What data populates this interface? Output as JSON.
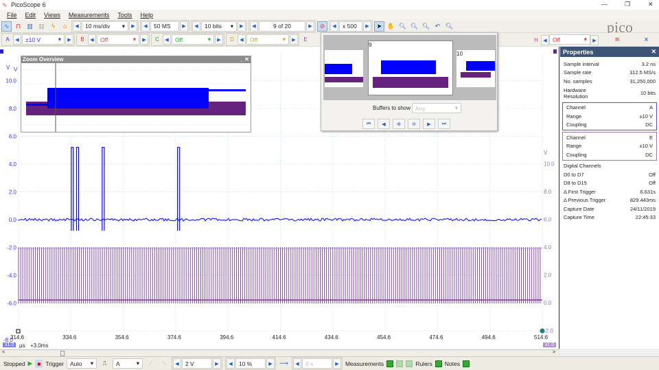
{
  "app": {
    "title": "PicoScope 6",
    "logo": "pico"
  },
  "menu": [
    "File",
    "Edit",
    "Views",
    "Measurements",
    "Tools",
    "Help"
  ],
  "toolbar1": {
    "timebase": "10 ms/div",
    "samples": "50 MS",
    "resolution": "10 bits",
    "buffer": "9 of 20",
    "zoom": "x 500"
  },
  "channels": [
    {
      "id": "A",
      "value": "±10 V",
      "color": "#3333ee"
    },
    {
      "id": "B",
      "value": "Off",
      "color": "#e03030"
    },
    {
      "id": "C",
      "value": "Off",
      "color": "#22aa22"
    },
    {
      "id": "D",
      "value": "Off",
      "color": "#c8a020"
    },
    {
      "id": "E",
      "value": "",
      "color": "#9a50b0"
    },
    {
      "id": "H",
      "value": "Off",
      "color": "#e0308a"
    }
  ],
  "overview": {
    "title": "Zoom Overview",
    "yunit": "V",
    "yticks": [
      "10.0",
      "8.0",
      "6.0"
    ]
  },
  "buffers": {
    "labels": [
      "9",
      "10"
    ],
    "buffers_to_show_label": "Buffers to show",
    "buffers_to_show_value": "Any"
  },
  "plot": {
    "left_axis": {
      "unit": "V",
      "ticks": [
        "10.0",
        "8.0",
        "6.0",
        "4.0",
        "2.0",
        "0.0",
        "-2.0",
        "-4.0",
        "-6.0",
        "-8.0"
      ],
      "color": "#3333ee"
    },
    "right_axis": {
      "unit": "V",
      "ticks": [
        "10.0",
        "8.0",
        "6.0",
        "4.0",
        "2.0",
        "0.0",
        "-2.0"
      ],
      "color": "#9a70b8"
    },
    "x_ticks": [
      "314.6",
      "334.6",
      "354.6",
      "374.6",
      "394.6",
      "414.6",
      "434.6",
      "454.6",
      "474.6",
      "494.6",
      "514.6"
    ],
    "x_unit": "µs",
    "x_offset": "+3.0ms",
    "left_scale_badge": "x1.0",
    "right_scale_badge": "x1.0",
    "pulse_times_us": [
      335.0,
      337.0,
      346.8,
      375.6
    ],
    "colors": {
      "channel_a": "#0000ff",
      "channel_e": "#7a3a9a"
    }
  },
  "properties": {
    "title": "Properties",
    "rows": [
      [
        "Sample interval",
        "3.2 ns"
      ],
      [
        "Sample rate",
        "312.5 MS/s"
      ],
      [
        "No. samples",
        "31,250,000"
      ],
      [
        "Hardware Resolution",
        "10 bits"
      ]
    ],
    "channel_a": [
      [
        "Channel",
        "A"
      ],
      [
        "Range",
        "±10 V"
      ],
      [
        "Coupling",
        "DC"
      ]
    ],
    "channel_e": [
      [
        "Channel",
        "E"
      ],
      [
        "Range",
        "±10 V"
      ],
      [
        "Coupling",
        "DC"
      ]
    ],
    "digital_title": "Digital Channels",
    "rows2": [
      [
        "D0 to D7",
        "Off"
      ],
      [
        "D8 to D15",
        "Off"
      ],
      [
        "Δ First Trigger",
        "6.631s"
      ],
      [
        "Δ Previous Trigger",
        "829.443ms"
      ],
      [
        "Capture Date",
        "24/11/2019"
      ],
      [
        "Capture Time",
        "22:45:33"
      ]
    ]
  },
  "status": {
    "state": "Stopped",
    "trigger_label": "Trigger",
    "trigger_mode": "Auto",
    "trigger_source": "A",
    "threshold": "2 V",
    "pretrigger": "10 %",
    "delay": "0 s",
    "measurements": "Measurements",
    "rulers": "Rulers",
    "notes": "Notes"
  }
}
